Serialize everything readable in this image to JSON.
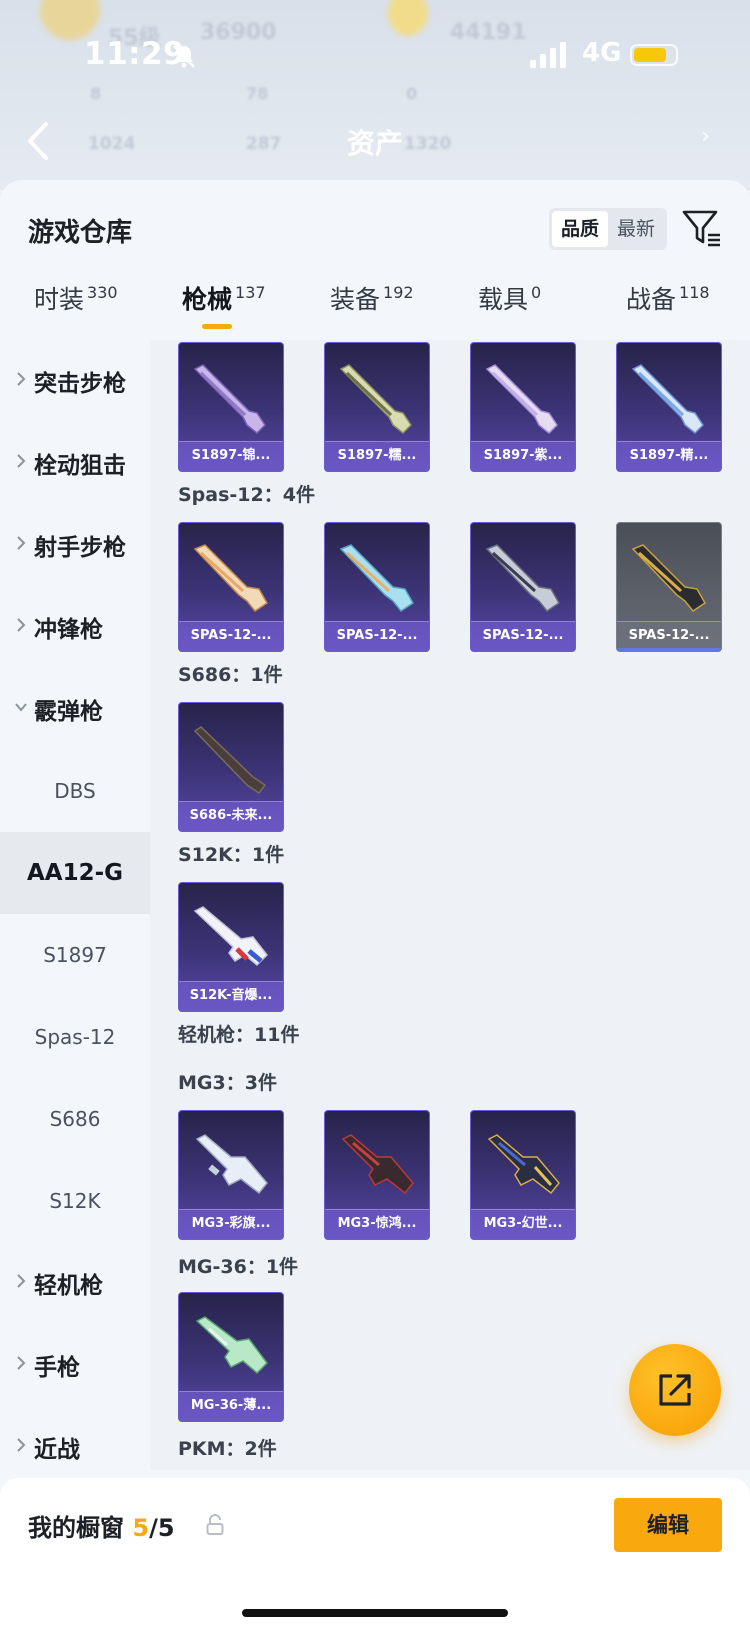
{
  "status_bar": {
    "time": "11:29",
    "network": "4G"
  },
  "bg_header": {
    "level": "55级",
    "coins": "36900",
    "score": "44191",
    "stat_a": "8",
    "stat_b": "78",
    "stat_c": "0",
    "stat_d": "1024",
    "stat_e": "287",
    "title_num": "1320"
  },
  "nav": {
    "title": "资产"
  },
  "sheet": {
    "title": "游戏仓库",
    "sort_options": [
      "品质",
      "最新"
    ],
    "sort_active": "品质"
  },
  "tabs": [
    {
      "label": "时装",
      "count": "330"
    },
    {
      "label": "枪械",
      "count": "137",
      "active": true
    },
    {
      "label": "装备",
      "count": "192"
    },
    {
      "label": "载具",
      "count": "0"
    },
    {
      "label": "战备",
      "count": "118"
    }
  ],
  "sidebar": {
    "categories": [
      {
        "label": "突击步枪"
      },
      {
        "label": "栓动狙击"
      },
      {
        "label": "射手步枪"
      },
      {
        "label": "冲锋枪"
      },
      {
        "label": "霰弹枪",
        "expanded": true
      }
    ],
    "sub_items": [
      {
        "label": "DBS"
      },
      {
        "label": "AA12-G",
        "active": true
      },
      {
        "label": "S1897"
      },
      {
        "label": "Spas-12"
      },
      {
        "label": "S686"
      },
      {
        "label": "S12K"
      }
    ],
    "bottom_categories": [
      {
        "label": "轻机枪"
      },
      {
        "label": "手枪"
      },
      {
        "label": "近战"
      }
    ]
  },
  "content": {
    "row1": [
      "S1897-锦...",
      "S1897-糯...",
      "S1897-紫...",
      "S1897-精..."
    ],
    "groups": [
      {
        "label": "Spas-12：4件",
        "items": [
          "SPAS-12-...",
          "SPAS-12-...",
          "SPAS-12-...",
          "SPAS-12-..."
        ]
      },
      {
        "label": "S686：1件",
        "items": [
          "S686-未来..."
        ]
      },
      {
        "label": "S12K：1件",
        "items": [
          "S12K-音爆..."
        ]
      },
      {
        "label": "轻机枪：11件"
      },
      {
        "label": "MG3：3件",
        "items": [
          "MG3-彩旗...",
          "MG3-惊鸿...",
          "MG3-幻世..."
        ]
      },
      {
        "label": "MG-36：1件",
        "items": [
          "MG-36-薄..."
        ]
      },
      {
        "label": "PKM：2件"
      }
    ]
  },
  "bottom": {
    "showcase_label": "我的橱窗",
    "showcase_current": "5",
    "showcase_total": "/5",
    "edit_label": "编辑"
  },
  "colors": {
    "accent": "#f9a80d",
    "card_purple": "#3d3478",
    "sheet_bg": "#f3f6fa"
  }
}
